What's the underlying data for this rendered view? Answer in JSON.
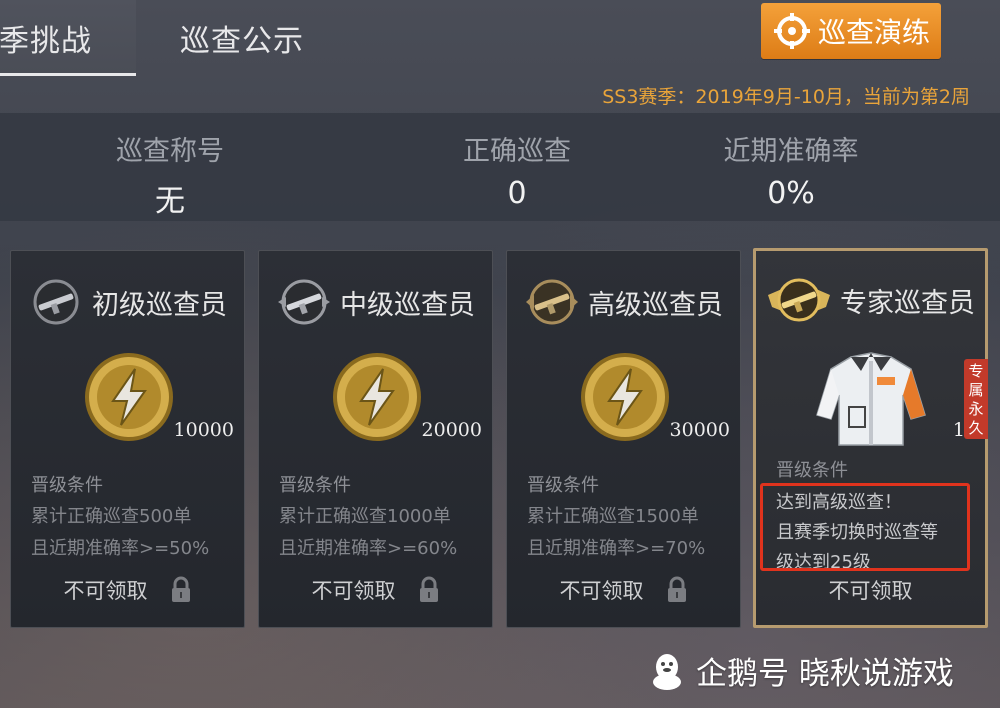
{
  "tabs": {
    "active": "季挑战",
    "second": "巡查公示"
  },
  "drill_button": {
    "label": "巡查演练",
    "icon": "crosshair-icon"
  },
  "season_info": "SS3赛季：2019年9月-10月，当前为第2周",
  "stats": [
    {
      "label": "巡查称号",
      "value": "无"
    },
    {
      "label": "正确巡查",
      "value": "0"
    },
    {
      "label": "近期准确率",
      "value": "0%"
    }
  ],
  "cards": [
    {
      "title": "初级巡查员",
      "badge_icon": "rifle-badge-icon",
      "reward_icon": "lightning-coin-icon",
      "reward_qty": "10000",
      "cond_title": "晋级条件",
      "cond_lines": [
        "累计正确巡查500单",
        "且近期准确率>=50%"
      ],
      "claim": "不可领取"
    },
    {
      "title": "中级巡查员",
      "badge_icon": "rifle-badge-icon",
      "reward_icon": "lightning-coin-icon",
      "reward_qty": "20000",
      "cond_title": "晋级条件",
      "cond_lines": [
        "累计正确巡查1000单",
        "且近期准确率>=60%"
      ],
      "claim": "不可领取"
    },
    {
      "title": "高级巡查员",
      "badge_icon": "rifle-badge-icon",
      "reward_icon": "lightning-coin-icon",
      "reward_qty": "30000",
      "cond_title": "晋级条件",
      "cond_lines": [
        "累计正确巡查1500单",
        "且近期准确率>=70%"
      ],
      "claim": "不可领取"
    },
    {
      "title": "专家巡查员",
      "badge_icon": "winged-rifle-badge-icon",
      "reward_icon": "jacket-icon",
      "reward_qty": "1",
      "tag": "专属永久",
      "cond_title": "晋级条件",
      "cond_lines": [
        "达到高级巡查！",
        "且赛季切换时巡查等",
        "级达到25级"
      ],
      "claim": "不可领取"
    }
  ],
  "watermark": "企鹅号 晓秋说游戏",
  "colors": {
    "accent_orange": "#e9a43a",
    "highlight_red": "#e0331d",
    "gold": "#b69b6f"
  }
}
